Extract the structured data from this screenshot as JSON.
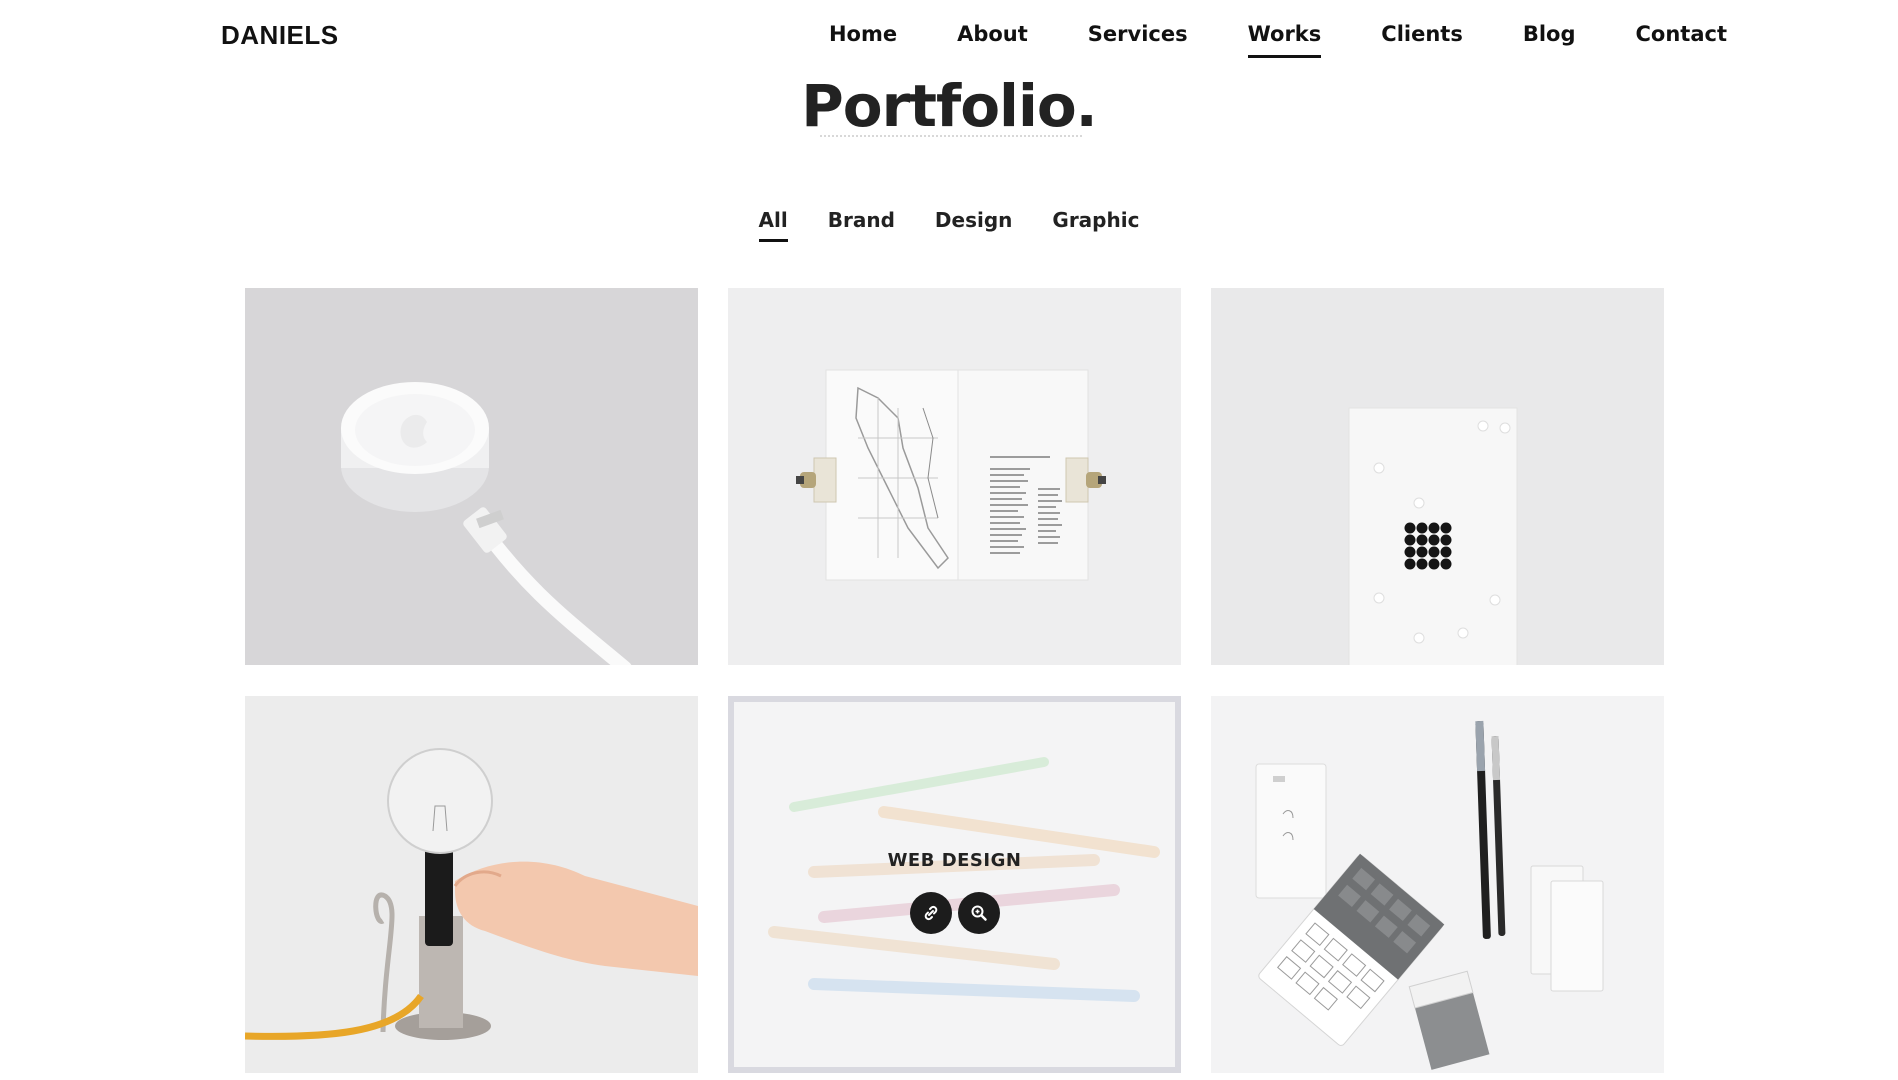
{
  "header": {
    "logo": "DANIELS",
    "nav": [
      {
        "label": "Home"
      },
      {
        "label": "About"
      },
      {
        "label": "Services"
      },
      {
        "label": "Works"
      },
      {
        "label": "Clients"
      },
      {
        "label": "Blog"
      },
      {
        "label": "Contact"
      }
    ],
    "active_nav": "Works"
  },
  "main": {
    "title": "Portfolio.",
    "filters": [
      {
        "label": "All"
      },
      {
        "label": "Brand"
      },
      {
        "label": "Design"
      },
      {
        "label": "Graphic"
      }
    ],
    "active_filter": "All",
    "portfolio": [
      {
        "image": "charger-puck-photo"
      },
      {
        "image": "map-booklet-photo"
      },
      {
        "image": "dotted-card-photo"
      },
      {
        "image": "bulb-lamp-photo"
      },
      {
        "image": "pastel-sticks-photo",
        "overlay_title": "WEB DESIGN",
        "icons": [
          "link-icon",
          "zoom-icon"
        ]
      },
      {
        "image": "stationery-set-photo"
      }
    ]
  },
  "colors": {
    "text": "#222222",
    "accent_underline": "#111111",
    "hover_border": "#d9d9e0",
    "button_bg": "#1c1c1c"
  }
}
